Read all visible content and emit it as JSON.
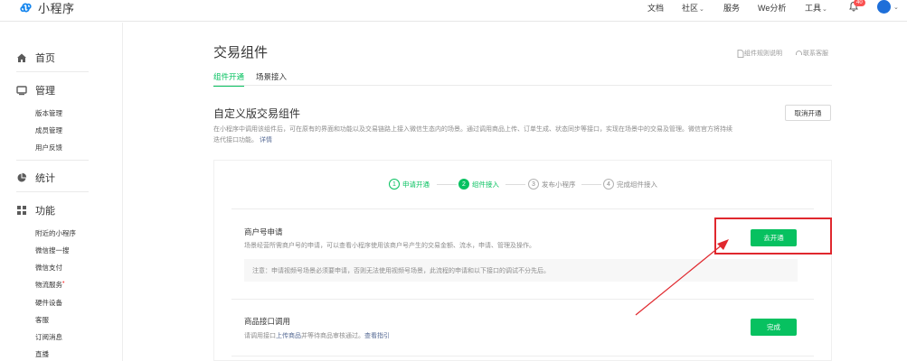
{
  "app": {
    "name": "小程序"
  },
  "topnav": {
    "items": [
      "文档",
      "社区",
      "服务",
      "We分析",
      "工具"
    ],
    "notification_count": "40"
  },
  "sidebar": {
    "home": "首页",
    "manage": "管理",
    "manage_items": [
      "版本管理",
      "成员管理",
      "用户反馈"
    ],
    "stats": "统计",
    "features": "功能",
    "feature_items": [
      "附近的小程序",
      "微信搜一搜",
      "微信支付",
      "物流服务",
      "硬件设备",
      "客服",
      "订阅消息",
      "直播"
    ]
  },
  "main": {
    "title": "交易组件",
    "rules_link": "组件规则说明",
    "contact_link": "联系客服",
    "tabs": [
      "组件开通",
      "场景接入"
    ],
    "section_title": "自定义版交易组件",
    "cancel_button": "取消开通",
    "description": "在小程序中调用该组件后，可在原有的界面和功能以及交易链路上接入微信生态内的场景。通过调用商品上传、订单生成、状态同步等接口，实现在场景中的交易及管理。微信官方将持续迭代接口功能。",
    "description_link": "详情",
    "steps": [
      {
        "num": "1",
        "label": "申请开通"
      },
      {
        "num": "2",
        "label": "组件接入"
      },
      {
        "num": "3",
        "label": "发布小程序"
      },
      {
        "num": "4",
        "label": "完成组件接入"
      }
    ],
    "items": [
      {
        "title": "商户号申请",
        "desc": "场景经营所需商户号的申请，可以查看小程序使用该商户号产生的交易金额、流水，申请、管理及操作。",
        "notice": "注意：申请视频号场景必须要申请，否则无法使用视频号场景，此流程的申请和以下接口的调试不分先后。",
        "button": "去开通"
      },
      {
        "title": "商品接口调用",
        "desc_prefix": "请调用接口",
        "desc_link1": "上传商品",
        "desc_middle": "并等待商品审核通过。",
        "desc_link2": "查看指引",
        "button": "完成"
      }
    ]
  },
  "colors": {
    "accent": "#07c160",
    "highlight": "#e0282e",
    "link": "#576b95"
  }
}
